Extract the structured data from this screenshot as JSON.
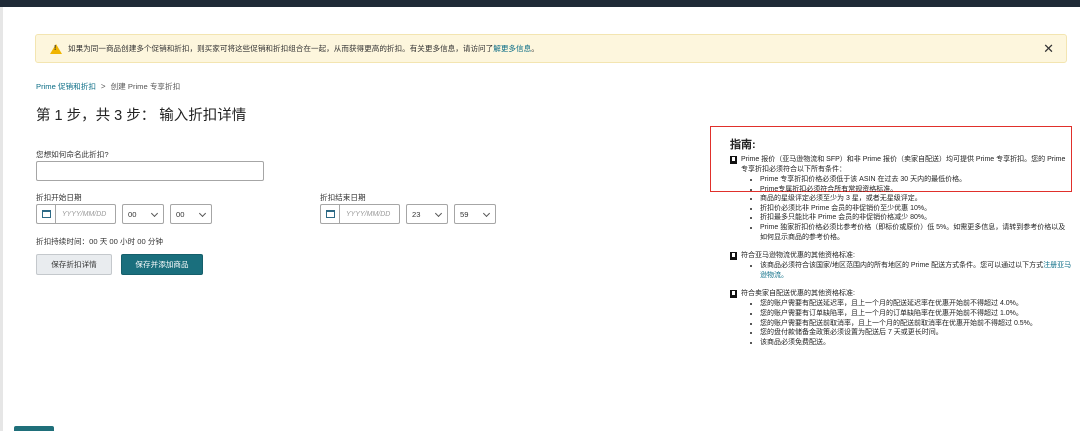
{
  "alert": {
    "text": "如果为同一商品创建多个促销和折扣，则买家可将这些促销和折扣组合在一起，从而获得更高的折扣。有关更多信息，请访问了",
    "link": "解更多信息",
    "text_after": "。"
  },
  "breadcrumb": {
    "parent": "Prime 促销和折扣",
    "separator": ">",
    "current": "创建 Prime 专享折扣"
  },
  "page_title": "第 1 步，共 3 步：  输入折扣详情",
  "form": {
    "name_label": "您想如何命名此折扣?",
    "name_value": "",
    "start_label": "折扣开始日期",
    "end_label": "折扣结束日期",
    "start": {
      "date_placeholder": "YYYY/MM/DD",
      "hour": "00",
      "minute": "00"
    },
    "end": {
      "date_placeholder": "YYYY/MM/DD",
      "hour": "23",
      "minute": "59"
    },
    "duration": "折扣持续时间：00 天 00 小时 00 分钟",
    "save_label": "保存折扣详情",
    "save_add_label": "保存并添加商品"
  },
  "guide": {
    "title": "指南:",
    "intro": "Prime 报价（亚马逊物流和 SFP）和非 Prime 报价（卖家自配送）均可提供 Prime 专享折扣。您的 Prime 专享折扣必须符合以下所有条件：",
    "conditions": [
      "Prime 专享折扣价格必须低于该 ASIN 在过去 30 天内的最低价格。",
      "Prime专属折扣必须符合所有常规资格标准。",
      "商品的星级评定必须至少为 3 星，或者无星级评定。",
      "折扣价必须比非 Prime 会员的非促销价至少优惠 10%。",
      "折扣最多只能比非 Prime 会员的非促销价格减少 80%。",
      "Prime 独家折扣价格必须比参考价格（即标价或原价）低 5%。如需更多信息，请转到参考价格以及如何显示商品的参考价格。"
    ],
    "fba_head": "符合亚马逊物流优惠的其他资格标准:",
    "fba_item_text": "该商品必须符合该国家/地区范围内的所有地区的 Prime 配送方式条件。您可以通过以下方式",
    "fba_item_link": "注册亚马逊物流。",
    "mfn_head": "符合卖家自配送优惠的其他资格标准:",
    "mfn_items": [
      "您的账户需要有配送延迟率，且上一个月的配送延迟率在优惠开始前不得超过 4.0%。",
      "您的账户需要有订单缺陷率，且上一个月的订单缺陷率在优惠开始前不得超过 1.0%。",
      "您的账户需要有配送前取消率，且上一个月的配送前取消率在优惠开始前不得超过 0.5%。",
      "您的盘付款储备金政策必须设置为配送后 7 天或更长时间。",
      "该商品必须免费配送。"
    ]
  }
}
